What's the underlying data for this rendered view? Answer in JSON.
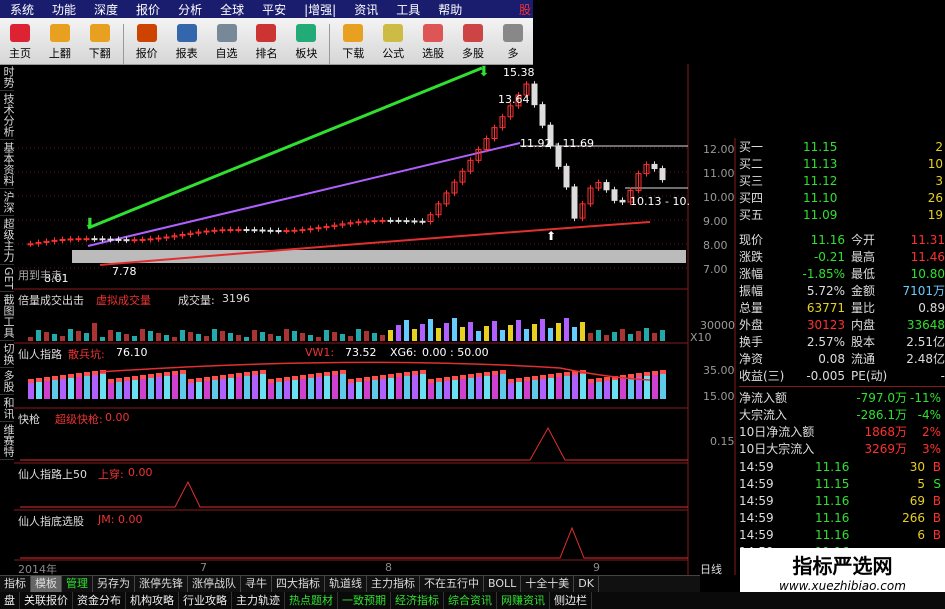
{
  "menu": [
    "系统",
    "功能",
    "深度",
    "报价",
    "分析",
    "全球",
    "平安",
    "|增强|",
    "资讯",
    "工具",
    "帮助"
  ],
  "menu_brand": "股",
  "toolbar": [
    {
      "label": "主页",
      "icon": "home-icon",
      "color": "#d23"
    },
    {
      "label": "上翻",
      "icon": "arrow-up-icon",
      "color": "#e8a020"
    },
    {
      "label": "下翻",
      "icon": "arrow-down-icon",
      "color": "#e8a020"
    },
    {
      "label": "报价",
      "icon": "yen-icon",
      "color": "#c40"
    },
    {
      "label": "报表",
      "icon": "report-icon",
      "color": "#36a"
    },
    {
      "label": "自选",
      "icon": "f6-icon",
      "color": "#789"
    },
    {
      "label": "排名",
      "icon": "rank-icon",
      "color": "#c33"
    },
    {
      "label": "板块",
      "icon": "sector-icon",
      "color": "#2a7"
    },
    {
      "label": "下载",
      "icon": "download-icon",
      "color": "#e8a020"
    },
    {
      "label": "公式",
      "icon": "formula-icon",
      "color": "#cb4"
    },
    {
      "label": "选股",
      "icon": "pick-icon",
      "color": "#d55"
    },
    {
      "label": "多股",
      "icon": "multi-icon",
      "color": "#c44"
    },
    {
      "label": "多",
      "icon": "more-icon",
      "color": "#888"
    }
  ],
  "leftnav": [
    "时势",
    "技术分析",
    "基本资料",
    "沪深",
    "超级主力",
    "GET",
    "截图工具",
    "切换",
    "多股",
    "和讯",
    "维赛特"
  ],
  "main_chart": {
    "price_labels": [
      "15.38",
      "13.64",
      "11.92",
      "11.69",
      "10.13",
      "10.",
      "8.01",
      "7.78"
    ],
    "axis": [
      "12.00",
      "11.00",
      "10.00",
      "9.00",
      "8.00",
      "7.00"
    ],
    "note": "用到丰走"
  },
  "volume_panel": {
    "title": "倍量成交出击",
    "sub": "虚拟成交量",
    "vol_label": "成交量:",
    "vol_value": "3196",
    "axis": [
      "30000"
    ],
    "unit": "X10"
  },
  "panel2": {
    "title": "仙人指路",
    "ind": "散兵坑:",
    "ind_val": "76.10",
    "ind2": "VW1:",
    "ind2_val": "73.52",
    "ind3": "XG6:",
    "ind3_val": "0.00 : 50.00",
    "axis": [
      "35.00",
      "15.00"
    ]
  },
  "panel3": {
    "title": "快枪",
    "ind": "超级快枪:",
    "ind_val": "0.00",
    "axis": [
      "0.15"
    ]
  },
  "panel4": {
    "title": "仙人指路上50",
    "ind": "上穿:",
    "ind_val": "0.00"
  },
  "panel5": {
    "title": "仙人指底选股",
    "ind": "JM:",
    "ind_val": "0.00"
  },
  "date_labels": [
    "2014年",
    "7",
    "8",
    "9"
  ],
  "period": "日线",
  "order_book": [
    {
      "label": "买一",
      "price": "11.15",
      "vol": "2"
    },
    {
      "label": "买二",
      "price": "11.13",
      "vol": "10"
    },
    {
      "label": "买三",
      "price": "11.12",
      "vol": "3"
    },
    {
      "label": "买四",
      "price": "11.10",
      "vol": "26"
    },
    {
      "label": "买五",
      "price": "11.09",
      "vol": "19"
    }
  ],
  "quote_rows": [
    {
      "l1": "现价",
      "v1": "11.16",
      "l2": "今开",
      "v2": "11.31"
    },
    {
      "l1": "涨跌",
      "v1": "-0.21",
      "l2": "最高",
      "v2": "11.46"
    },
    {
      "l1": "涨幅",
      "v1": "-1.85%",
      "l2": "最低",
      "v2": "10.80"
    },
    {
      "l1": "振幅",
      "v1": "5.72%",
      "l2": "金额",
      "v2": "7101万"
    },
    {
      "l1": "总量",
      "v1": "63771",
      "l2": "量比",
      "v2": "0.89"
    },
    {
      "l1": "外盘",
      "v1": "30123",
      "l2": "内盘",
      "v2": "33648"
    },
    {
      "l1": "换手",
      "v1": "2.57%",
      "l2": "股本",
      "v2": "2.51亿"
    },
    {
      "l1": "净资",
      "v1": "0.08",
      "l2": "流通",
      "v2": "2.48亿"
    },
    {
      "l1": "收益(三)",
      "v1": "-0.005",
      "l2": "PE(动)",
      "v2": "-"
    }
  ],
  "flow_rows": [
    {
      "label": "净流入额",
      "value": "-797.0万",
      "pct": "-11%"
    },
    {
      "label": "大宗流入",
      "value": "-286.1万",
      "pct": "-4%"
    },
    {
      "label": "10日净流入额",
      "value": "1868万",
      "pct": "2%"
    },
    {
      "label": "10日大宗流入",
      "value": "3269万",
      "pct": "3%"
    }
  ],
  "ticks": [
    {
      "time": "14:59",
      "price": "11.16",
      "vol": "30",
      "side": "B"
    },
    {
      "time": "14:59",
      "price": "11.15",
      "vol": "5",
      "side": "S"
    },
    {
      "time": "14:59",
      "price": "11.16",
      "vol": "69",
      "side": "B"
    },
    {
      "time": "14:59",
      "price": "11.16",
      "vol": "266",
      "side": "B"
    },
    {
      "time": "14:59",
      "price": "11.16",
      "vol": "6",
      "side": "B"
    },
    {
      "time": "14:59",
      "price": "11.16",
      "vol": "",
      "side": ""
    }
  ],
  "bottom_tabs": [
    "指标",
    "模板",
    "管理",
    "另存为",
    "涨停先锋",
    "涨停战队",
    "寻牛",
    "四大指标",
    "轨道线",
    "主力指标",
    "不在五行中",
    "BOLL",
    "十全十美",
    "DK"
  ],
  "bottom2": [
    "盘",
    "关联报价",
    "资金分布",
    "机构攻略",
    "行业攻略",
    "主力轨迹",
    "热点题材",
    "一致预期",
    "经济指标",
    "综合资讯",
    "网赚资讯",
    "侧边栏"
  ],
  "watermark_title": "指标严选网",
  "watermark_url": "www.xuezhibiao.com",
  "colors": {
    "up": "#ff3030",
    "down": "#00e0e0",
    "green": "#30e030",
    "yellow": "#e8d020",
    "purple": "#b060ff"
  }
}
